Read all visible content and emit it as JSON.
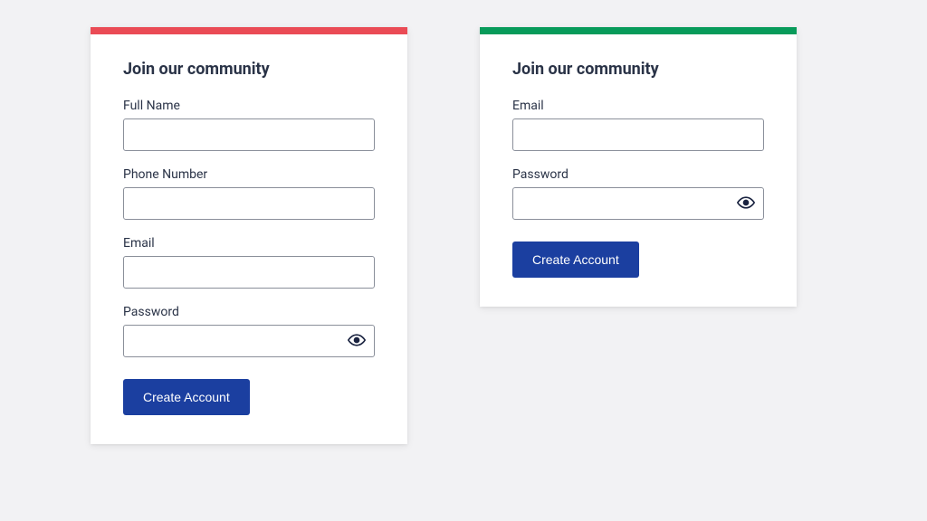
{
  "card_left": {
    "accent_color": "#ea4b55",
    "title": "Join our community",
    "fields": {
      "full_name": {
        "label": "Full Name",
        "value": ""
      },
      "phone": {
        "label": "Phone Number",
        "value": ""
      },
      "email": {
        "label": "Email",
        "value": ""
      },
      "password": {
        "label": "Password",
        "value": ""
      }
    },
    "submit_label": "Create Account"
  },
  "card_right": {
    "accent_color": "#089b5a",
    "title": "Join our community",
    "fields": {
      "email": {
        "label": "Email",
        "value": ""
      },
      "password": {
        "label": "Password",
        "value": ""
      }
    },
    "submit_label": "Create Account"
  }
}
